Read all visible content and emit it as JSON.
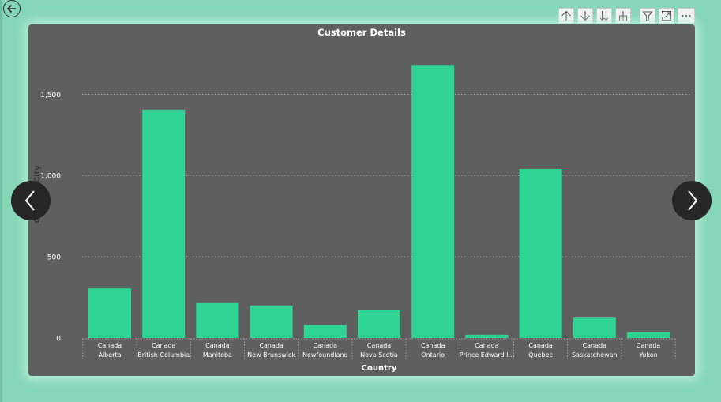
{
  "toolbar": {
    "buttons": [
      "arrow-up-icon",
      "arrow-down-icon",
      "double-arrow-down-icon",
      "expand-hierarchy-icon",
      "filter-icon",
      "focus-mode-icon",
      "more-options-icon"
    ]
  },
  "colors": {
    "page_bg": "#86d6b8",
    "card_bg": "#5f5f5f",
    "bar": "#2fd495",
    "text": "#ffffff"
  },
  "chart_data": {
    "type": "bar",
    "title": "Customer Details",
    "xlabel": "Country",
    "ylabel": "Count of City",
    "categories": [
      [
        "Canada",
        "Alberta"
      ],
      [
        "Canada",
        "British Columbia"
      ],
      [
        "Canada",
        "Manitoba"
      ],
      [
        "Canada",
        "New Brunswick"
      ],
      [
        "Canada",
        "Newfoundland"
      ],
      [
        "Canada",
        "Nova Scotia"
      ],
      [
        "Canada",
        "Ontario"
      ],
      [
        "Canada",
        "Prince Edward I..."
      ],
      [
        "Canada",
        "Quebec"
      ],
      [
        "Canada",
        "Saskatchewan"
      ],
      [
        "Canada",
        "Yukon"
      ]
    ],
    "values": [
      305,
      1405,
      215,
      200,
      80,
      170,
      1680,
      20,
      1040,
      125,
      35
    ],
    "ylim": [
      0,
      1750
    ],
    "yticks": [
      0,
      500,
      1000,
      1500
    ],
    "ytick_labels": [
      "0",
      "500",
      "1,000",
      "1,500"
    ],
    "grid": true
  }
}
